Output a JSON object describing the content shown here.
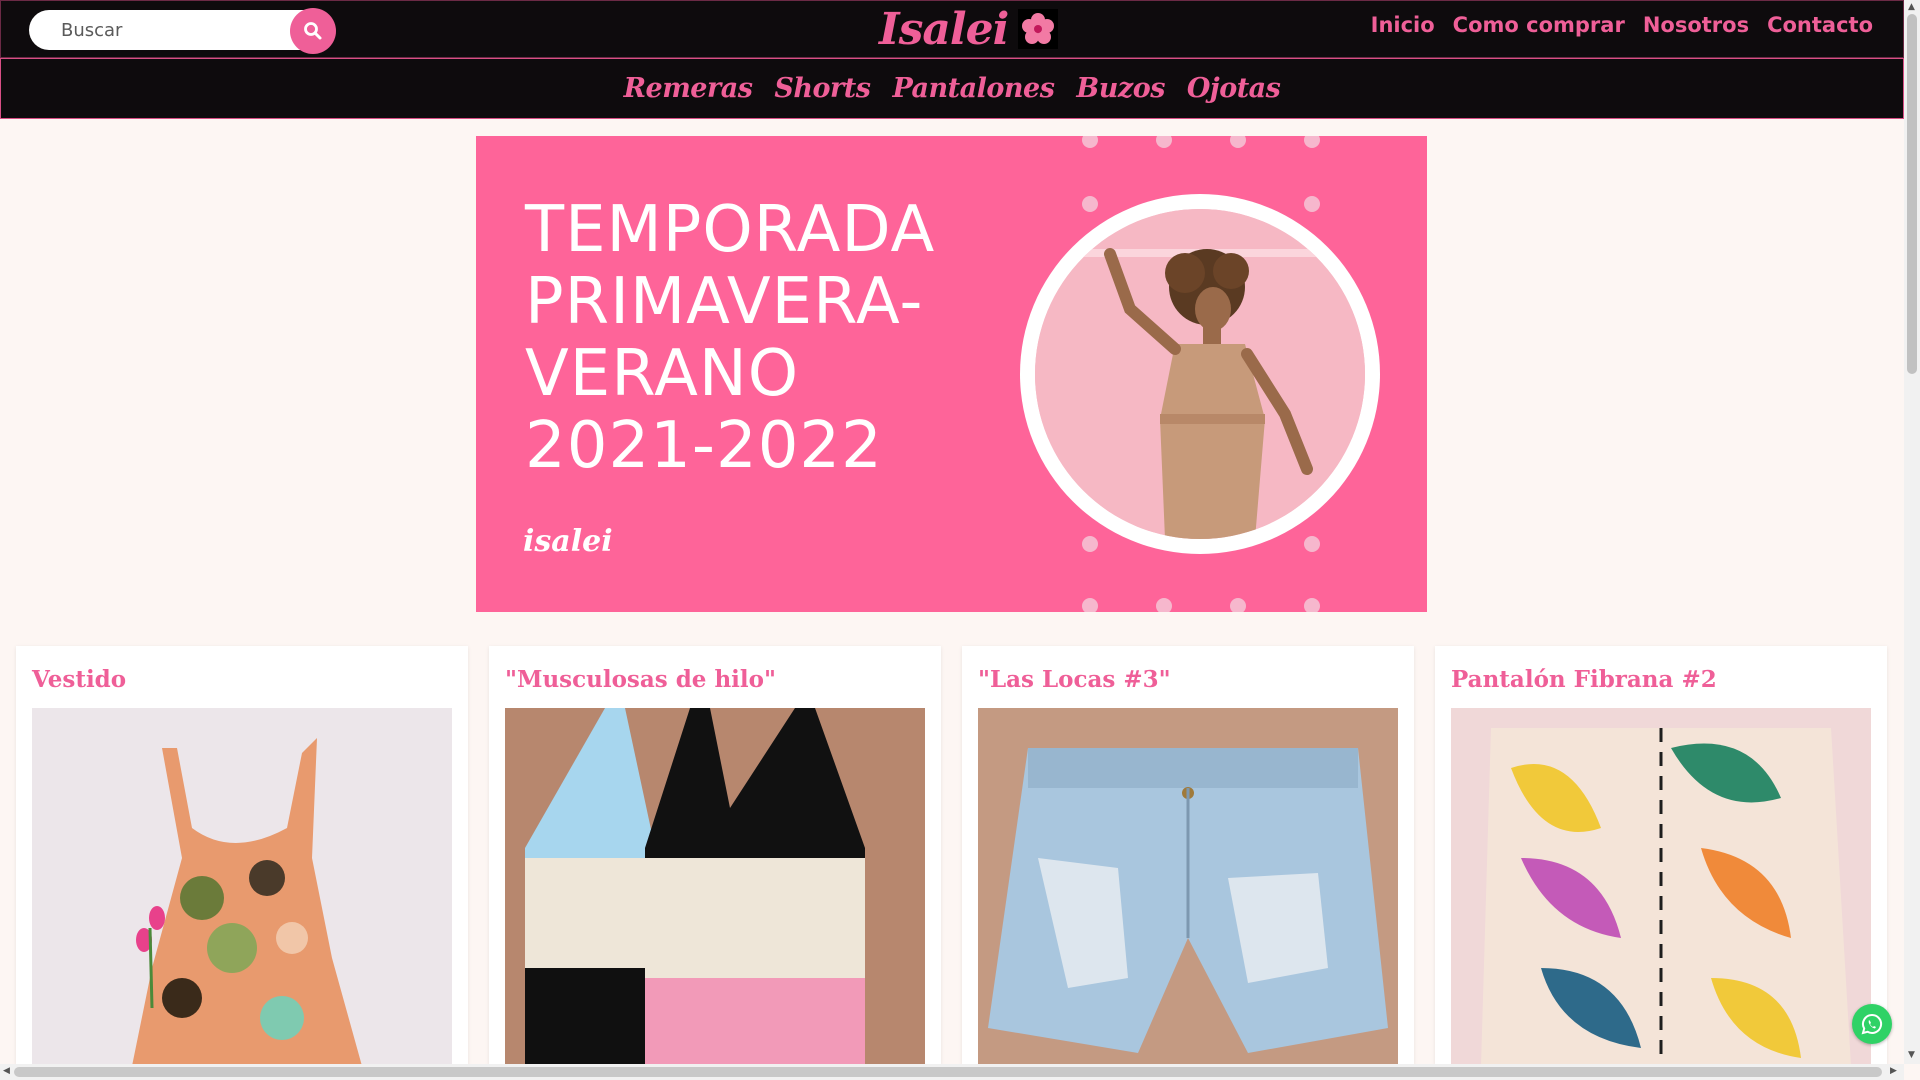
{
  "search": {
    "placeholder": "Buscar"
  },
  "brand": {
    "name": "Isalei"
  },
  "topnav": [
    "Inicio",
    "Como comprar",
    "Nosotros",
    "Contacto"
  ],
  "categories": [
    "Remeras",
    "Shorts",
    "Pantalones",
    "Buzos",
    "Ojotas"
  ],
  "banner": {
    "title_lines": [
      "TEMPORADA",
      "PRIMAVERA-",
      "VERANO",
      "2021-2022"
    ],
    "signature": "isalei"
  },
  "products": [
    {
      "title": "Vestido"
    },
    {
      "title": "\"Musculosas de hilo\""
    },
    {
      "title": "\"Las Locas #3\""
    },
    {
      "title": "Pantalón Fibrana #2"
    }
  ],
  "colors": {
    "accent": "#ef5f98",
    "banner": "#fe6499",
    "bar": "#0e0b0d",
    "page": "#fdf6f3"
  }
}
